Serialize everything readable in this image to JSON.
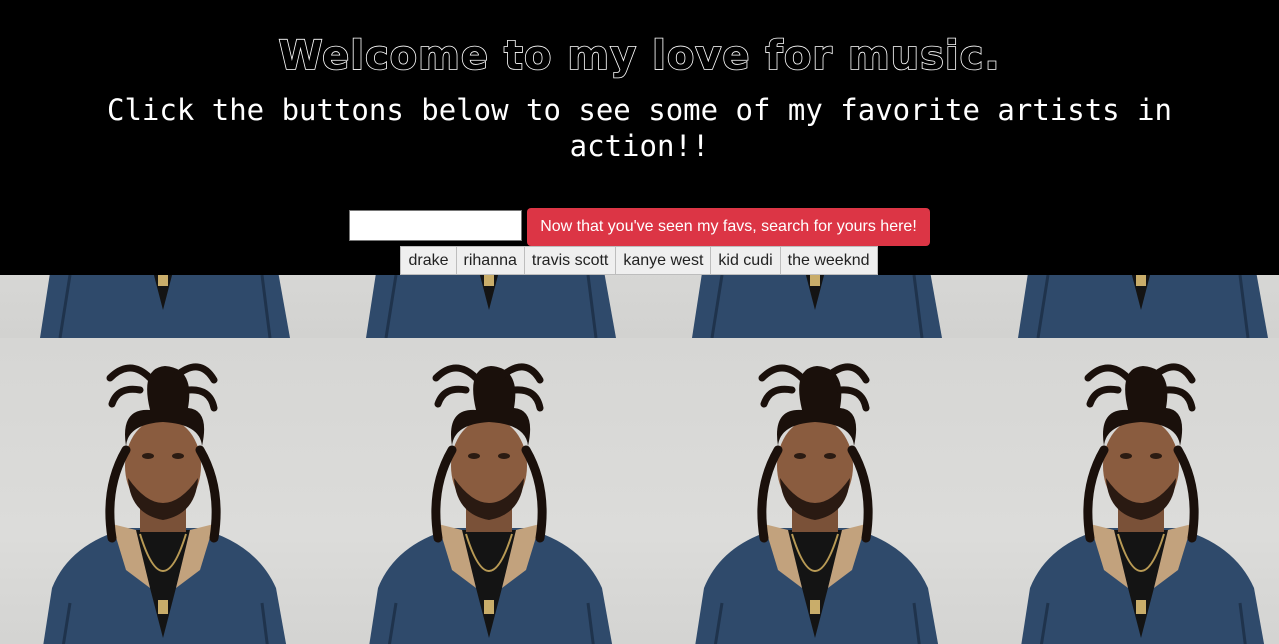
{
  "header": {
    "title": "Welcome to my love for music.",
    "subtitle": "Click the buttons below to see some of my favorite artists in action!!"
  },
  "search": {
    "input_value": "",
    "button_label": "Now that you've seen my favs, search for yours here!"
  },
  "artists": [
    "drake",
    "rihanna",
    "travis scott",
    "kanye west",
    "kid cudi",
    "the weeknd"
  ],
  "colors": {
    "header_bg": "#000000",
    "button_red": "#dc3545",
    "denim": "#2f4a6b",
    "collar": "#c2a27d"
  }
}
